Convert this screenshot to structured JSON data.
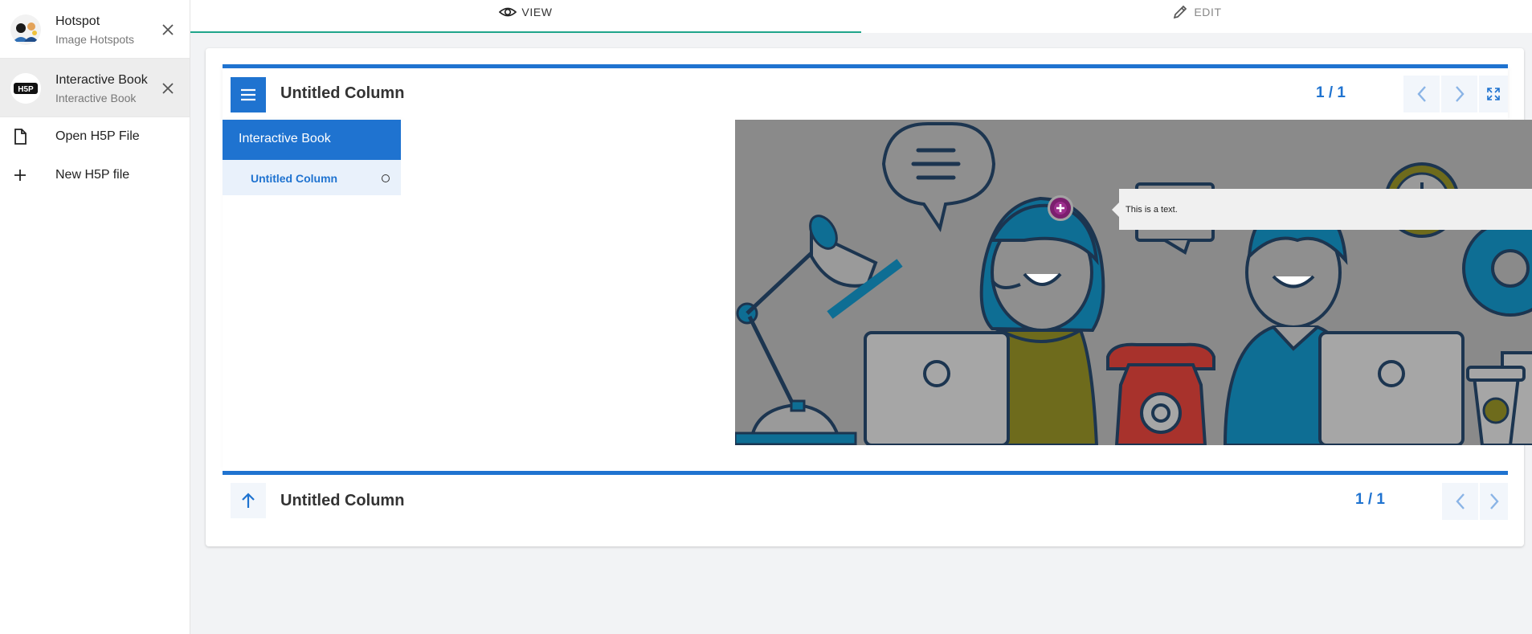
{
  "sidebar": {
    "files": [
      {
        "title": "Hotspot",
        "subtitle": "Image Hotspots",
        "active": false
      },
      {
        "title": "Interactive Book",
        "subtitle": "Interactive Book",
        "active": true
      }
    ],
    "actions": [
      {
        "label": "Open H5P File",
        "icon": "file-icon"
      },
      {
        "label": "New H5P file",
        "icon": "plus-icon"
      }
    ]
  },
  "tabs": [
    {
      "label": "VIEW",
      "icon": "eye-icon",
      "active": true
    },
    {
      "label": "EDIT",
      "icon": "pencil-icon",
      "active": false
    }
  ],
  "book": {
    "header": {
      "title": "Untitled Column",
      "page_count": "1 / 1"
    },
    "toc": {
      "title": "Interactive Book",
      "items": [
        {
          "label": "Untitled Column"
        }
      ]
    },
    "popup": {
      "text": "This is a text.",
      "close": "×"
    },
    "footer": {
      "title": "Untitled Column",
      "page_count": "1 / 1"
    }
  },
  "colors": {
    "accent": "#1f73d0",
    "tab_indicator": "#1fa58a",
    "hotspot": "#7b1f6e"
  }
}
